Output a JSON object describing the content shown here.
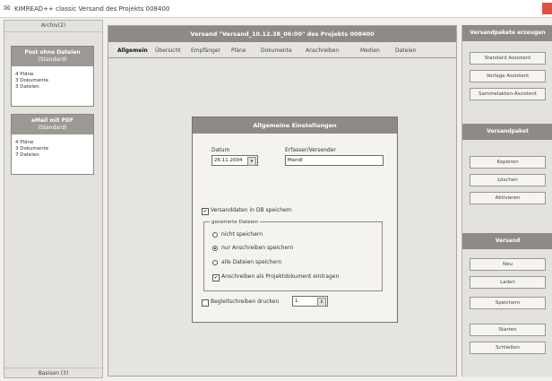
{
  "window": {
    "title": "KIMREAD++ classic Versand des Projekts 008400"
  },
  "left_panel": {
    "header": "Archiv(2)",
    "footer": "Basisen (3)",
    "cards": [
      {
        "title": "Post ohne Dateien",
        "subtitle": "(Standard)",
        "lines": [
          "4 Pläne",
          "3 Dokumente",
          "3 Dateien"
        ]
      },
      {
        "title": "eMail mit PDF",
        "subtitle": "(Standard)",
        "lines": [
          "4 Pläne",
          "3 Dokumente",
          "7 Dateien"
        ]
      }
    ]
  },
  "main": {
    "title": "Versand \"Versand_10.12.38_06:00\" des Projekts 008400",
    "tabs": [
      "Allgemein",
      "Übersicht",
      "Empfänger",
      "Pläne",
      "Dokumente",
      "Anschreiben",
      "Medien",
      "Dateien"
    ],
    "active_tab": "Allgemein"
  },
  "dialog": {
    "title": "Allgemeine Einstellungen",
    "datum_label": "Datum",
    "datum_value": "26.11.2004",
    "erfasser_label": "Erfasser/Versender",
    "erfasser_value": "Mandl",
    "check_db": {
      "label": "Versanddaten in DB speichern",
      "checked": true
    },
    "group": {
      "legend": "generierte Dateien",
      "options": [
        {
          "label": "nicht speichern",
          "selected": false
        },
        {
          "label": "nur Anschreiben speichern",
          "selected": true
        },
        {
          "label": "alle Dateien speichern",
          "selected": false
        }
      ],
      "check_anschreiben": {
        "label": "Anschreiben als Projektdokument eintragen",
        "checked": true
      }
    },
    "check_begleit": {
      "label": "Begleitschreiben drucken",
      "checked": false
    },
    "begleit_count": "1"
  },
  "right_panel": {
    "sections": [
      {
        "title": "Versandpakete erzeugen",
        "buttons": [
          "Standard Assistent",
          "Vorlage Assistent",
          "Sammelakten-Assistent"
        ]
      },
      {
        "title": "Versandpaket",
        "buttons": [
          "Kopieren",
          "Löschen",
          "Aktivieren"
        ]
      },
      {
        "title": "Versand",
        "buttons": [
          "Neu",
          "Laden",
          "Speichern",
          "Starten",
          "Schließen"
        ]
      }
    ]
  },
  "icons": {
    "app": "app-icon",
    "close": "close-icon"
  },
  "colors": {
    "panel_header": "#8e8b86",
    "background": "#f1f0ec",
    "close": "#e05040"
  }
}
